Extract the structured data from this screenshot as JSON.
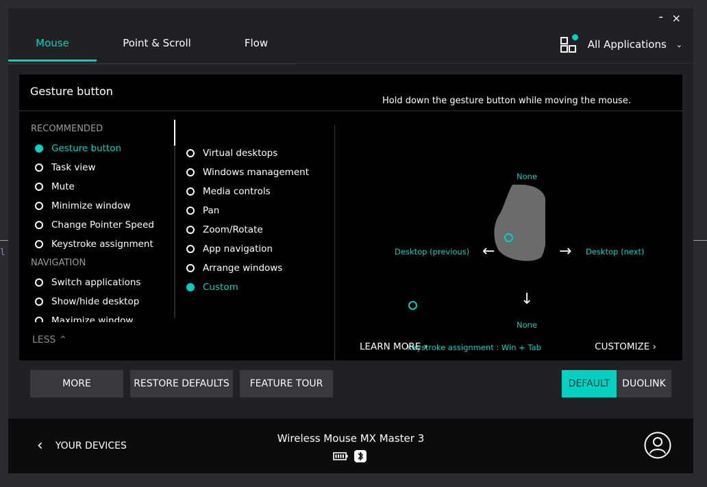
{
  "window": {
    "minimize": "-",
    "close": "×"
  },
  "tabs": [
    {
      "label": "Mouse"
    },
    {
      "label": "Point & Scroll"
    },
    {
      "label": "Flow"
    }
  ],
  "apps": {
    "label": "All Applications"
  },
  "panel": {
    "title": "Gesture button",
    "hint": "Hold down the gesture button while moving the mouse.",
    "recommended_head": "RECOMMENDED",
    "recommended": [
      "Gesture button",
      "Task view",
      "Mute",
      "Minimize window",
      "Change Pointer Speed",
      "Keystroke assignment"
    ],
    "navigation_head": "NAVIGATION",
    "navigation": [
      "Switch applications",
      "Show/hide desktop",
      "Maximize window"
    ],
    "less": "LESS",
    "gestures": [
      "Virtual desktops",
      "Windows management",
      "Media controls",
      "Pan",
      "Zoom/Rotate",
      "App navigation",
      "Arrange windows",
      "Custom"
    ],
    "diagram": {
      "up": "None",
      "down": "None",
      "left": "Desktop (previous)",
      "right": "Desktop (next)",
      "click": "Keystroke assignment : Win + Tab"
    },
    "learn_more": "LEARN MORE",
    "customize": "CUSTOMIZE"
  },
  "buttons": {
    "more": "MORE",
    "restore": "RESTORE DEFAULTS",
    "tour": "FEATURE TOUR",
    "default": "DEFAULT",
    "duolink": "DUOLINK"
  },
  "footer": {
    "back": "YOUR DEVICES",
    "device": "Wireless Mouse MX Master 3"
  },
  "colors": {
    "accent": "#00d1c1",
    "panel": "#000000",
    "window": "#202124"
  }
}
